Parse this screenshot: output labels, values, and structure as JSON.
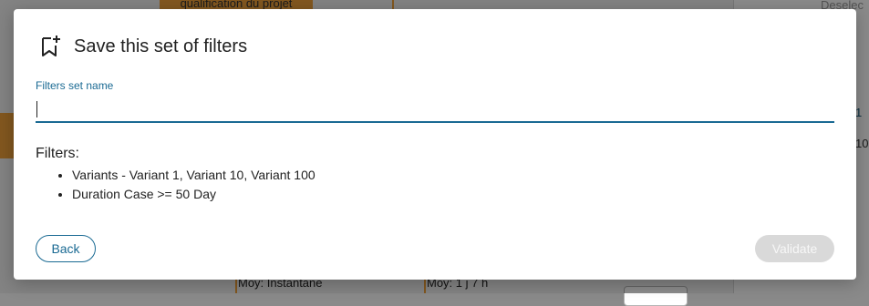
{
  "background": {
    "chip_text": "qualification du projet",
    "right_top_text": "Deselec",
    "right_fragment_1": "1",
    "right_fragment_2": "10",
    "bottom_left_text": "Moy: Instantane",
    "bottom_mid_text": "Moy: 1 j 7 h"
  },
  "modal": {
    "title": "Save this set of filters",
    "field_label": "Filters set name",
    "name_value": "",
    "filters_heading": "Filters:",
    "filters": [
      "Variants - Variant 1, Variant 10, Variant 100",
      "Duration Case >= 50 Day"
    ],
    "back_label": "Back",
    "validate_label": "Validate",
    "validate_disabled": true
  },
  "icons": {
    "title_icon": "bookmark-add-icon"
  },
  "colors": {
    "accent": "#1a6a93",
    "disabled_bg": "#d9d9d9",
    "orange": "#f0a23a"
  }
}
